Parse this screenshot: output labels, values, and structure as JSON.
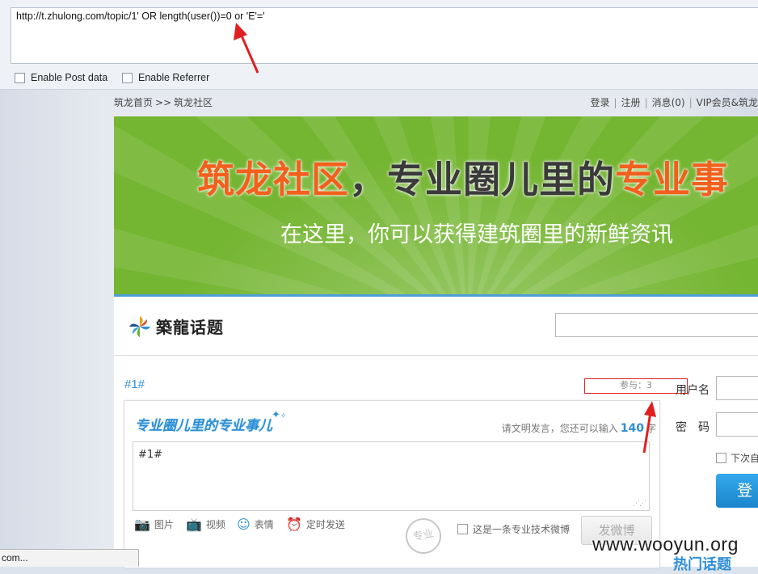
{
  "hackbar": {
    "url": "http://t.zhulong.com/topic/1' OR length(user())=0 or 'E'='",
    "enable_post_label": "Enable Post data",
    "enable_referrer_label": "Enable Referrer"
  },
  "topnav": {
    "home": "筑龙首页",
    "sep": ">>",
    "community": "筑龙社区",
    "login": "登录",
    "register": "注册",
    "messages": "消息(0)",
    "vip": "VIP会员&筑龙"
  },
  "banner": {
    "title_part1": "筑龙社区",
    "title_comma": "，",
    "title_part2": "专业圈儿里的",
    "title_part3": "专业事",
    "subtitle": "在这里，你可以获得建筑圈里的新鲜资讯"
  },
  "header": {
    "logo_text": "築龍话题",
    "search_placeholder": ""
  },
  "topic": {
    "tag": "#1#",
    "participants": "参与：3"
  },
  "composer": {
    "slogan": "专业圈儿里的专业事儿",
    "hint_prefix": "请文明发言，您还可以输入",
    "hint_count": "140",
    "hint_suffix": "字",
    "textarea_value": "#1#",
    "tool_image": "图片",
    "tool_video": "视频",
    "tool_emoji": "表情",
    "tool_schedule": "定时发送",
    "watermark": "专业",
    "tech_check_label": "这是一条专业技术微博",
    "publish_label": "发微博"
  },
  "login": {
    "username_label": "用户名",
    "password_label": "密　码",
    "remember_label": "下次自",
    "login_button": "登录",
    "hot_topics": "热门话题"
  },
  "statusbar": {
    "text": "com..."
  },
  "watermark_site": "www.wooyun.org",
  "colors": {
    "banner_green": "#74b531",
    "accent_blue": "#2f8fd8",
    "title_orange": "#f2601d",
    "annotation_red": "#e02020"
  }
}
